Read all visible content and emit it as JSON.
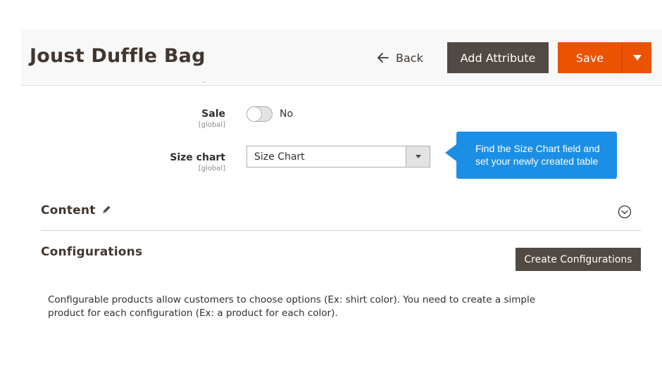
{
  "header": {
    "title": "Joust Duffle Bag",
    "back_label": "Back",
    "add_attribute_label": "Add Attribute",
    "save_label": "Save"
  },
  "fields": {
    "sale": {
      "label": "Sale",
      "scope": "[global]",
      "value_text": "No",
      "enabled": false
    },
    "size_chart": {
      "label": "Size chart",
      "scope": "[global]",
      "selected": "Size Chart"
    }
  },
  "tooltip": {
    "line1": "Find the Size Chart field and",
    "line2": "set your newly created table"
  },
  "sections": {
    "content": {
      "title": "Content"
    },
    "configurations": {
      "title": "Configurations",
      "button_label": "Create Configurations",
      "description_line1": "Configurable products allow customers to choose options (Ex: shirt color). You need to create a simple",
      "description_line2": "product for each configuration (Ex: a product for each color)."
    }
  },
  "icons": {
    "back": "arrow-left-icon",
    "save_dropdown": "caret-down-icon",
    "select_arrow": "caret-down-icon",
    "content_edit": "pencil-icon",
    "content_toggle": "chevron-down-circle-icon"
  },
  "colors": {
    "primary_action": "#eb5202",
    "secondary_action": "#514943",
    "tooltip": "#1b8fe6",
    "header_bg": "#f8f8f8"
  }
}
